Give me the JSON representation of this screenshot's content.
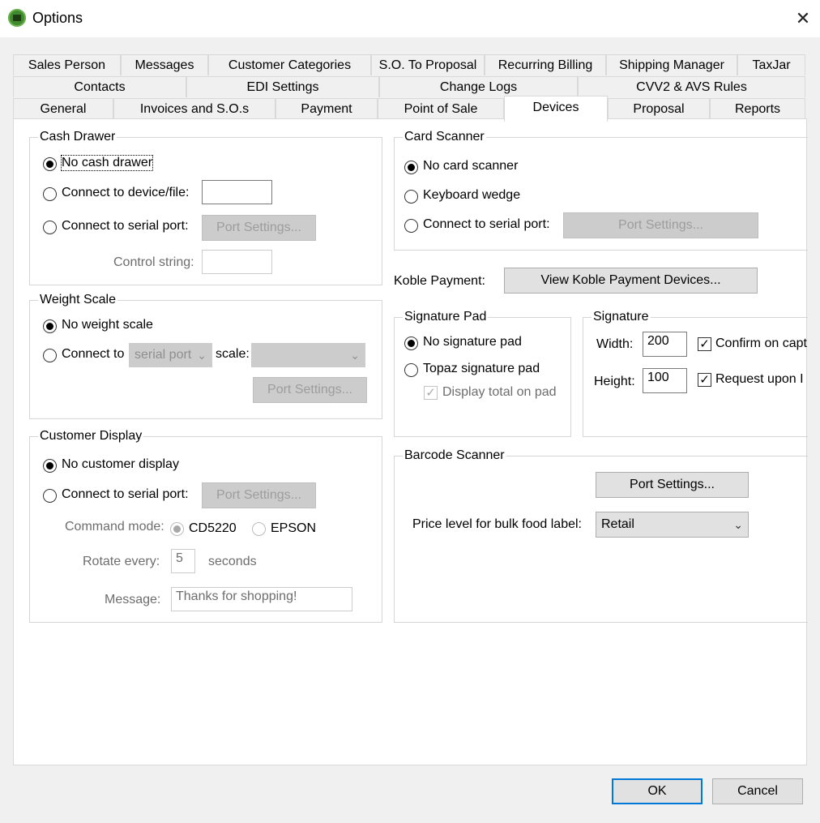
{
  "window": {
    "title": "Options",
    "close": "✕"
  },
  "tabs": {
    "row1": [
      "Sales Person",
      "Messages",
      "Customer Categories",
      "S.O. To Proposal",
      "Recurring Billing",
      "Shipping Manager",
      "TaxJar"
    ],
    "row2": [
      "Contacts",
      "EDI Settings",
      "Change Logs",
      "CVV2 & AVS Rules"
    ],
    "row3": [
      "General",
      "Invoices and S.O.s",
      "Payment",
      "Point of Sale",
      "Devices",
      "Proposal",
      "Reports"
    ],
    "active": "Devices"
  },
  "cash_drawer": {
    "title": "Cash Drawer",
    "no_cash_drawer": "No cash drawer",
    "connect_device": "Connect to device/file:",
    "device_value": "",
    "connect_serial": "Connect to serial port:",
    "port_settings": "Port Settings...",
    "control_string_label": "Control string:",
    "control_string_value": ""
  },
  "weight_scale": {
    "title": "Weight Scale",
    "no_weight_scale": "No weight scale",
    "connect_to": "Connect to",
    "port_type": "serial port",
    "scale_label": "scale:",
    "scale_value": "",
    "port_settings": "Port Settings..."
  },
  "customer_display": {
    "title": "Customer Display",
    "no_customer_display": "No customer display",
    "connect_serial": "Connect to serial port:",
    "port_settings": "Port Settings...",
    "command_mode_label": "Command mode:",
    "mode_cd5220": "CD5220",
    "mode_epson": "EPSON",
    "rotate_label": "Rotate every:",
    "rotate_value": "5",
    "seconds": "seconds",
    "message_label": "Message:",
    "message_value": "Thanks for shopping!"
  },
  "card_scanner": {
    "title": "Card Scanner",
    "no_card_scanner": "No card scanner",
    "keyboard_wedge": "Keyboard wedge",
    "connect_serial": "Connect to serial port:",
    "port_settings": "Port Settings..."
  },
  "koble": {
    "label": "Koble Payment:",
    "button": "View Koble Payment Devices..."
  },
  "signature_pad": {
    "title": "Signature Pad",
    "no_signature_pad": "No signature pad",
    "topaz": "Topaz signature pad",
    "display_total": "Display total on pad"
  },
  "signature": {
    "title": "Signature",
    "width_label": "Width:",
    "width_value": "200",
    "height_label": "Height:",
    "height_value": "100",
    "confirm": "Confirm on capt",
    "request": "Request upon I"
  },
  "barcode_scanner": {
    "title": "Barcode Scanner",
    "port_settings": "Port Settings...",
    "price_level_label": "Price level for bulk food label:",
    "price_level_value": "Retail"
  },
  "footer": {
    "ok": "OK",
    "cancel": "Cancel"
  }
}
